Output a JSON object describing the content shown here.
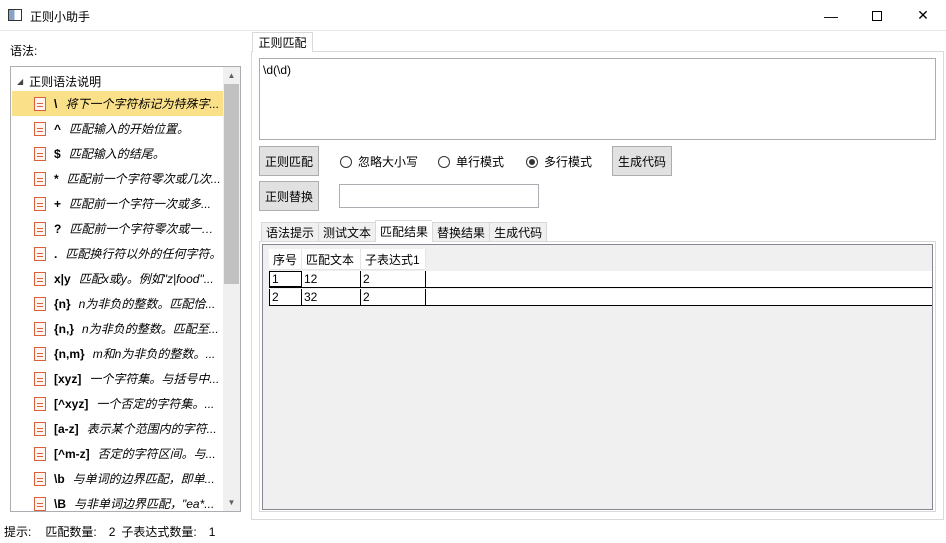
{
  "window": {
    "title": "正则小助手"
  },
  "left": {
    "label": "语法:",
    "root": "正则语法说明",
    "items": [
      {
        "key": "\\",
        "desc": "将下一个字符标记为特殊字..."
      },
      {
        "key": "^",
        "desc": "匹配输入的开始位置。"
      },
      {
        "key": "$",
        "desc": "匹配输入的结尾。"
      },
      {
        "key": "*",
        "desc": "匹配前一个字符零次或几次..."
      },
      {
        "key": "+",
        "desc": "匹配前一个字符一次或多..."
      },
      {
        "key": "?",
        "desc": "匹配前一个字符零次或一次..."
      },
      {
        "key": ".",
        "desc": "匹配换行符以外的任何字符。"
      },
      {
        "key": "x|y",
        "desc": "匹配x或y。例如\"z|food\"..."
      },
      {
        "key": "{n}",
        "desc": "n为非负的整数。匹配恰..."
      },
      {
        "key": "{n,}",
        "desc": "n为非负的整数。匹配至..."
      },
      {
        "key": "{n,m}",
        "desc": "m和n为非负的整数。..."
      },
      {
        "key": "[xyz]",
        "desc": "一个字符集。与括号中..."
      },
      {
        "key": "[^xyz]",
        "desc": "一个否定的字符集。..."
      },
      {
        "key": "[a-z]",
        "desc": "表示某个范围内的字符..."
      },
      {
        "key": "[^m-z]",
        "desc": "否定的字符区间。与..."
      },
      {
        "key": "\\b",
        "desc": "与单词的边界匹配，即单..."
      },
      {
        "key": "\\B",
        "desc": "与非单词边界匹配，\"ea*..."
      }
    ]
  },
  "status": {
    "hint_label": "提示:",
    "match_count_label": "匹配数量:",
    "match_count": "2",
    "group_count_label": "子表达式数量:",
    "group_count": "1"
  },
  "main": {
    "top_tab": "正则匹配",
    "regex_value": "\\d(\\d)",
    "match_button": "正则匹配",
    "replace_button": "正则替换",
    "gen_button": "生成代码",
    "options": [
      {
        "label": "忽略大小写",
        "checked": false
      },
      {
        "label": "单行模式",
        "checked": false
      },
      {
        "label": "多行模式",
        "checked": true
      }
    ],
    "replace_value": "",
    "tabs": [
      "语法提示",
      "测试文本",
      "匹配结果",
      "替换结果",
      "生成代码"
    ],
    "active_tab": "匹配结果",
    "table": {
      "columns": [
        "序号",
        "匹配文本",
        "子表达式1"
      ],
      "rows": [
        [
          "1",
          "12",
          "2"
        ],
        [
          "2",
          "32",
          "2"
        ]
      ]
    }
  }
}
